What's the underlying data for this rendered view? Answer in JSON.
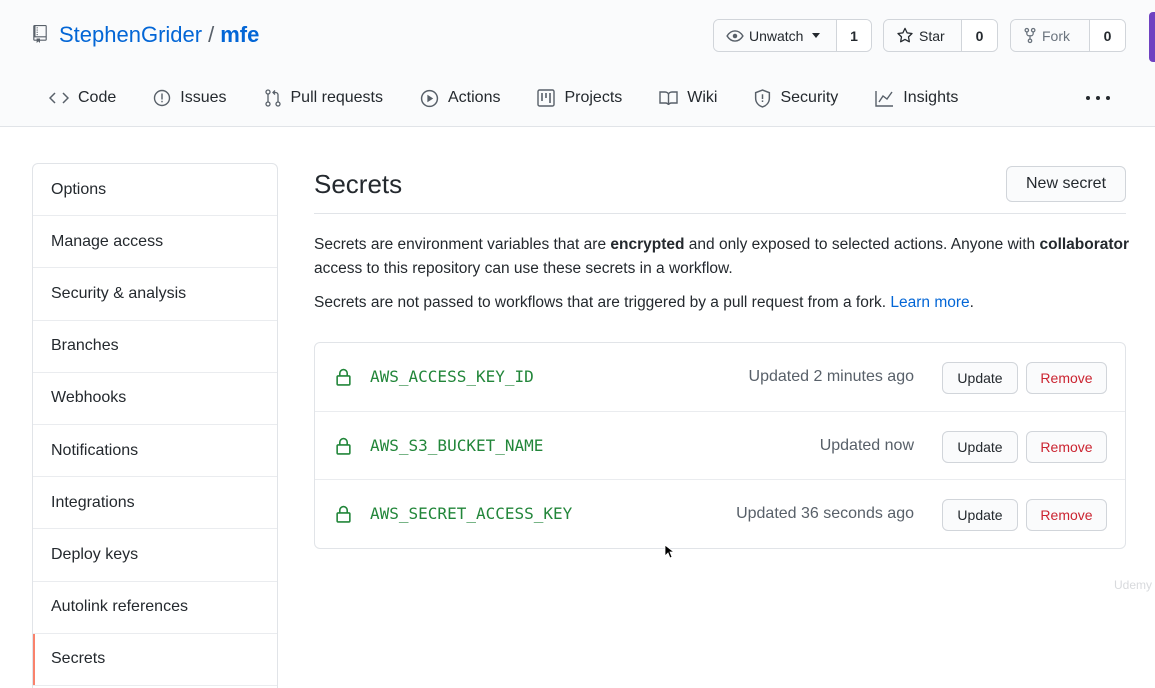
{
  "repo": {
    "owner": "StephenGrider",
    "separator": "/",
    "name": "mfe"
  },
  "actions": {
    "unwatch_label": "Unwatch",
    "unwatch_count": "1",
    "star_label": "Star",
    "star_count": "0",
    "fork_label": "Fork",
    "fork_count": "0"
  },
  "nav": [
    {
      "label": "Code",
      "icon": "code-icon"
    },
    {
      "label": "Issues",
      "icon": "issue-icon"
    },
    {
      "label": "Pull requests",
      "icon": "pull-request-icon"
    },
    {
      "label": "Actions",
      "icon": "play-icon"
    },
    {
      "label": "Projects",
      "icon": "project-icon"
    },
    {
      "label": "Wiki",
      "icon": "book-icon"
    },
    {
      "label": "Security",
      "icon": "shield-icon"
    },
    {
      "label": "Insights",
      "icon": "graph-icon"
    }
  ],
  "sidebar": {
    "items": [
      {
        "label": "Options"
      },
      {
        "label": "Manage access"
      },
      {
        "label": "Security & analysis"
      },
      {
        "label": "Branches"
      },
      {
        "label": "Webhooks"
      },
      {
        "label": "Notifications"
      },
      {
        "label": "Integrations"
      },
      {
        "label": "Deploy keys"
      },
      {
        "label": "Autolink references"
      },
      {
        "label": "Secrets",
        "selected": true
      }
    ]
  },
  "main": {
    "title": "Secrets",
    "new_secret_label": "New secret",
    "desc1": {
      "part1": "Secrets are environment variables that are ",
      "bold1": "encrypted",
      "part2": " and only exposed to selected actions. Anyone with ",
      "bold2": "collaborator",
      "part3": " access to this repository can use these secrets in a workflow."
    },
    "desc2": {
      "text": "Secrets are not passed to workflows that are triggered by a pull request from a fork. ",
      "link": "Learn more",
      "end": "."
    },
    "secrets": [
      {
        "name": "AWS_ACCESS_KEY_ID",
        "updated": "Updated 2 minutes ago",
        "update_label": "Update",
        "remove_label": "Remove"
      },
      {
        "name": "AWS_S3_BUCKET_NAME",
        "updated": "Updated now",
        "update_label": "Update",
        "remove_label": "Remove"
      },
      {
        "name": "AWS_SECRET_ACCESS_KEY",
        "updated": "Updated 36 seconds ago",
        "update_label": "Update",
        "remove_label": "Remove"
      }
    ]
  },
  "watermark": "Udemy",
  "colors": {
    "link": "#0366d6",
    "secret_name": "#22863a",
    "remove": "#cb2431",
    "selected_bar": "#f9826c",
    "accent_edge": "#6f42c1"
  }
}
